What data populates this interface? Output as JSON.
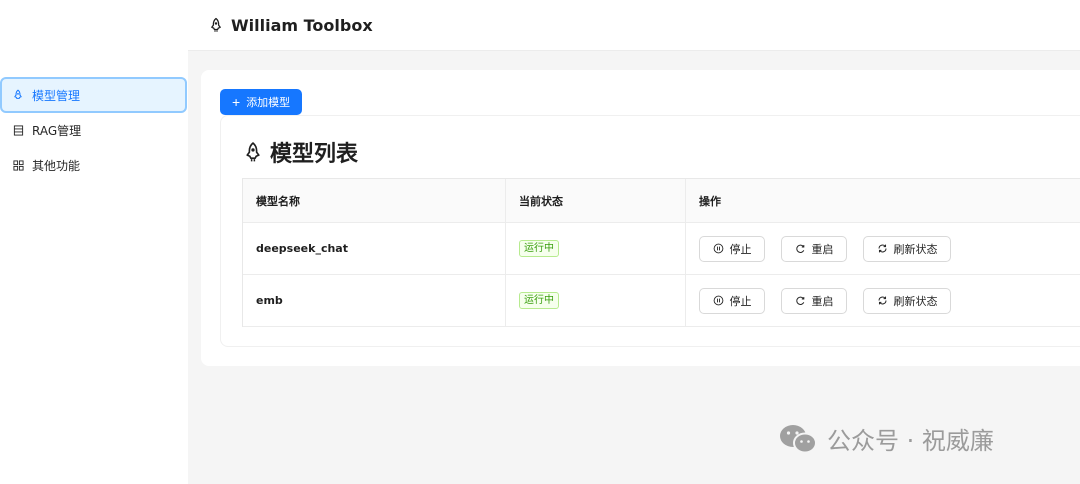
{
  "app": {
    "title": "William Toolbox",
    "logo_icon": "rocket-icon"
  },
  "sidebar": {
    "items": [
      {
        "label": "模型管理",
        "icon": "rocket-icon",
        "active": true
      },
      {
        "label": "RAG管理",
        "icon": "database-icon",
        "active": false
      },
      {
        "label": "其他功能",
        "icon": "appstore-icon",
        "active": false
      }
    ]
  },
  "toolbar": {
    "add_model_label": "添加模型"
  },
  "model_list": {
    "title": "模型列表",
    "columns": [
      "模型名称",
      "当前状态",
      "操作"
    ],
    "rows": [
      {
        "name": "deepseek_chat",
        "status": "运行中"
      },
      {
        "name": "emb",
        "status": "运行中"
      }
    ],
    "actions": {
      "stop": "停止",
      "restart": "重启",
      "refresh": "刷新状态"
    }
  },
  "watermark": {
    "text": "公众号 · 祝威廉"
  },
  "colors": {
    "primary": "#1677ff",
    "success": "#389e0d",
    "active_bg": "#e6f4ff"
  }
}
